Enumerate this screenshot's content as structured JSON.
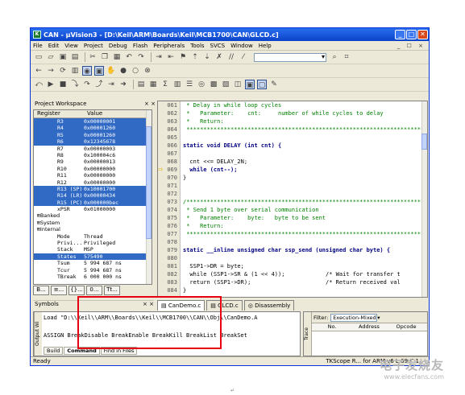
{
  "window": {
    "title": "CAN - µVision3 - [D:\\Keil\\ARM\\Boards\\Keil\\MCB1700\\CAN\\GLCD.c]",
    "app_icon": "keil-icon",
    "min": "_",
    "max": "□",
    "close": "✕"
  },
  "menu": [
    "File",
    "Edit",
    "View",
    "Project",
    "Debug",
    "Flash",
    "Peripherals",
    "Tools",
    "SVCS",
    "Window",
    "Help"
  ],
  "mdi_controls": "_ ☐ ×",
  "project_workspace": {
    "title": "Project Workspace",
    "close": "× ×",
    "col_register": "Register",
    "col_value": "Value",
    "registers": [
      {
        "name": "R3",
        "value": "0x00000001",
        "selected": true
      },
      {
        "name": "R4",
        "value": "0x00001260",
        "selected": true
      },
      {
        "name": "R5",
        "value": "0x00001260",
        "selected": true
      },
      {
        "name": "R6",
        "value": "0x12345678",
        "selected": true
      },
      {
        "name": "R7",
        "value": "0x00000003",
        "selected": false
      },
      {
        "name": "R8",
        "value": "0x100004c6",
        "selected": false
      },
      {
        "name": "R9",
        "value": "0x00000013",
        "selected": false
      },
      {
        "name": "R10",
        "value": "0x00000000",
        "selected": false
      },
      {
        "name": "R11",
        "value": "0x00000000",
        "selected": false
      },
      {
        "name": "R12",
        "value": "0x00000000",
        "selected": false
      },
      {
        "name": "R13 (SP)",
        "value": "0x10001700",
        "selected": true
      },
      {
        "name": "R14 (LR)",
        "value": "0x00000434",
        "selected": true
      },
      {
        "name": "R15 (PC)",
        "value": "0x000000bec",
        "selected": true
      },
      {
        "name": "xPSR",
        "value": "0x01000000",
        "selected": false
      },
      {
        "name": "Banked",
        "value": "",
        "group": true
      },
      {
        "name": "System",
        "value": "",
        "group": true
      },
      {
        "name": "Internal",
        "value": "",
        "group": true
      },
      {
        "name": "Mode",
        "value": "Thread",
        "selected": false
      },
      {
        "name": "Privi...",
        "value": "Privileged",
        "selected": false
      },
      {
        "name": "Stack",
        "value": "MSP",
        "selected": false
      },
      {
        "name": "States",
        "value": "575490",
        "selected": true
      },
      {
        "name": "Tsum",
        "value": "5 994 687  ns",
        "selected": false
      },
      {
        "name": "Tcur",
        "value": "5 994 687  ns",
        "selected": false
      },
      {
        "name": "TBreak",
        "value": "6 000 000  ns",
        "selected": false
      }
    ],
    "tabs": [
      "B...",
      "≡...",
      "{}...",
      "0...",
      "Tt..."
    ]
  },
  "editor": {
    "lines": [
      {
        "n": "061",
        "t": " * Delay in while loop cycles",
        "k": "comment"
      },
      {
        "n": "062",
        "t": " *   Parameter:    cnt:     number of while cycles to delay",
        "k": "comment"
      },
      {
        "n": "063",
        "t": " *   Return:",
        "k": "comment"
      },
      {
        "n": "064",
        "t": " ************************************************************************",
        "k": "comment"
      },
      {
        "n": "065",
        "t": "",
        "k": "code"
      },
      {
        "n": "066",
        "t": "static void DELAY (int cnt) {",
        "k": "kw"
      },
      {
        "n": "067",
        "t": "",
        "k": "code"
      },
      {
        "n": "068",
        "t": "  cnt <<= DELAY_2N;",
        "k": "code"
      },
      {
        "n": "069",
        "t": "  while (cnt--);",
        "k": "kw"
      },
      {
        "n": "070",
        "t": "}",
        "k": "code"
      },
      {
        "n": "071",
        "t": "",
        "k": "code"
      },
      {
        "n": "072",
        "t": "",
        "k": "code"
      },
      {
        "n": "073",
        "t": "/************************************************************************",
        "k": "comment"
      },
      {
        "n": "074",
        "t": " * Send 1 byte over serial communication",
        "k": "comment"
      },
      {
        "n": "075",
        "t": " *   Parameter:    byte:   byte to be sent",
        "k": "comment"
      },
      {
        "n": "076",
        "t": " *   Return:",
        "k": "comment"
      },
      {
        "n": "077",
        "t": " ************************************************************************",
        "k": "comment"
      },
      {
        "n": "078",
        "t": "",
        "k": "code"
      },
      {
        "n": "079",
        "t": "static __inline unsigned char ssp_send (unsigned char byte) {",
        "k": "kw"
      },
      {
        "n": "080",
        "t": "",
        "k": "code"
      },
      {
        "n": "081",
        "t": "  SSP1->DR = byte;",
        "k": "code"
      },
      {
        "n": "082",
        "t": "  while (SSP1->SR & (1 << 4));            /* Wait for transfer t",
        "k": "mix"
      },
      {
        "n": "083",
        "t": "  return (SSP1->DR);                      /* Return received val",
        "k": "mix"
      },
      {
        "n": "084",
        "t": "}",
        "k": "code"
      }
    ],
    "tabs": [
      "CanDemo.c",
      "GLCD.c",
      "Disassembly"
    ]
  },
  "symbols": {
    "title": "Symbols",
    "close": "× ×"
  },
  "output": {
    "side_label": "Output Wi",
    "line1": "Load \"D:\\\\Keil\\\\ARM\\\\Boards\\\\Keil\\\\MCB1700\\\\CAN\\\\Obj\\\\CanDemo.A",
    "line2": "ASSIGN BreakDisable BreakEnable BreakKill BreakList BreakSet",
    "tabs": [
      "Build",
      "Command",
      "Find in Files"
    ]
  },
  "trace": {
    "side_label": "Trace",
    "filter_label": "Filter:",
    "filter_value": "Execution-Mixed",
    "cols": [
      "No.",
      "Address",
      "Opcode"
    ]
  },
  "status": {
    "left": "Ready",
    "right": "TKScope R...     for ARM v6   L:69 C:1"
  },
  "watermark": {
    "main": "电子发烧友",
    "sub": "www.elecfans.com"
  },
  "page_mark": "↵"
}
